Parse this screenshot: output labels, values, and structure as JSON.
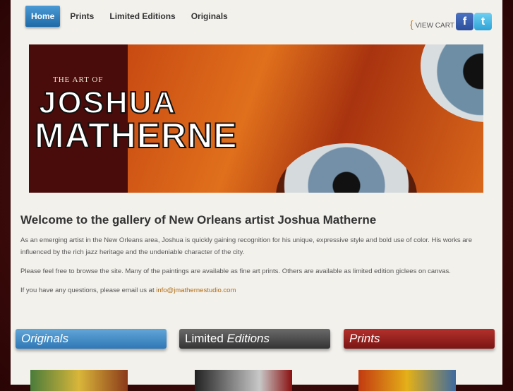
{
  "nav": {
    "items": [
      {
        "label": "Home",
        "active": true
      },
      {
        "label": "Prints"
      },
      {
        "label": "Limited Editions"
      },
      {
        "label": "Originals"
      }
    ]
  },
  "cart": {
    "label": "VIEW CART",
    "open_brace": "{",
    "close_brace": "}"
  },
  "social": {
    "facebook_icon": "f",
    "twitter_icon": "t"
  },
  "hero": {
    "subtitle": "THE ART OF",
    "name_line1": "JOSHUA",
    "name_line2": "MATHERNE"
  },
  "content": {
    "heading": "Welcome to the gallery of New Orleans artist Joshua Matherne",
    "p1": "As an emerging artist in the New Orleans area, Joshua is quickly gaining recognition for his unique, expressive style and bold use of color. His works are influenced by the rich jazz heritage and the undeniable character of the city.",
    "p2": "Please feel free to browse the site. Many of the paintings are available as fine art prints. Others are available as limited edition giclees on canvas.",
    "p3_prefix": "If you have any questions, please email us at ",
    "email": "info@jmathernestudio.com"
  },
  "boxes": {
    "originals": "Originals",
    "limited_word1": "Limited ",
    "limited_word2": "Editions",
    "prints": "Prints"
  },
  "colors": {
    "nav_active": "#2f7fc0",
    "accent": "#b06b13",
    "originals_box": "#3a86c4",
    "limited_box": "#444444",
    "prints_box": "#8e1d1a"
  }
}
